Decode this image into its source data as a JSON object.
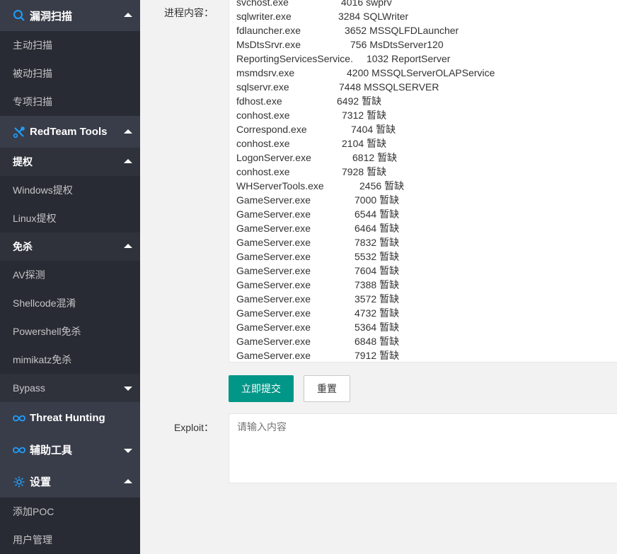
{
  "sidebar": {
    "vuln_scan": {
      "title": "漏洞扫描",
      "items": [
        "主动扫描",
        "被动扫描",
        "专项扫描"
      ]
    },
    "redteam": {
      "title": "RedTeam Tools",
      "privesc": {
        "title": "提权",
        "items": [
          "Windows提权",
          "Linux提权"
        ]
      },
      "evasion": {
        "title": "免杀",
        "items": [
          "AV探测",
          "Shellcode混淆",
          "Powershell免杀",
          "mimikatz免杀"
        ]
      },
      "bypass": {
        "title": "Bypass"
      }
    },
    "threat_hunting": {
      "title": "Threat Hunting"
    },
    "aux_tools": {
      "title": "辅助工具"
    },
    "settings": {
      "title": "设置",
      "items": [
        "添加POC",
        "用户管理"
      ]
    }
  },
  "form": {
    "process_label": "进程内容：",
    "processes": [
      {
        "name": "svchost.exe",
        "pid": "4016",
        "service": "swprv"
      },
      {
        "name": "sqlwriter.exe",
        "pid": "3284",
        "service": "SQLWriter"
      },
      {
        "name": "fdlauncher.exe",
        "pid": "3652",
        "service": "MSSQLFDLauncher"
      },
      {
        "name": "MsDtsSrvr.exe",
        "pid": "756",
        "service": "MsDtsServer120"
      },
      {
        "name": "ReportingServicesService.",
        "pid": "1032",
        "service": "ReportServer"
      },
      {
        "name": "msmdsrv.exe",
        "pid": "4200",
        "service": "MSSQLServerOLAPService"
      },
      {
        "name": "sqlservr.exe",
        "pid": "7448",
        "service": "MSSQLSERVER"
      },
      {
        "name": "fdhost.exe",
        "pid": "6492",
        "service": "暂缺"
      },
      {
        "name": "conhost.exe",
        "pid": "7312",
        "service": "暂缺"
      },
      {
        "name": "Correspond.exe",
        "pid": "7404",
        "service": "暂缺"
      },
      {
        "name": "conhost.exe",
        "pid": "2104",
        "service": "暂缺"
      },
      {
        "name": "LogonServer.exe",
        "pid": "6812",
        "service": "暂缺"
      },
      {
        "name": "conhost.exe",
        "pid": "7928",
        "service": "暂缺"
      },
      {
        "name": "WHServerTools.exe",
        "pid": "2456",
        "service": "暂缺"
      },
      {
        "name": "GameServer.exe",
        "pid": "7000",
        "service": "暂缺"
      },
      {
        "name": "GameServer.exe",
        "pid": "6544",
        "service": "暂缺"
      },
      {
        "name": "GameServer.exe",
        "pid": "6464",
        "service": "暂缺"
      },
      {
        "name": "GameServer.exe",
        "pid": "7832",
        "service": "暂缺"
      },
      {
        "name": "GameServer.exe",
        "pid": "5532",
        "service": "暂缺"
      },
      {
        "name": "GameServer.exe",
        "pid": "7604",
        "service": "暂缺"
      },
      {
        "name": "GameServer.exe",
        "pid": "7388",
        "service": "暂缺"
      },
      {
        "name": "GameServer.exe",
        "pid": "3572",
        "service": "暂缺"
      },
      {
        "name": "GameServer.exe",
        "pid": "4732",
        "service": "暂缺"
      },
      {
        "name": "GameServer.exe",
        "pid": "5364",
        "service": "暂缺"
      },
      {
        "name": "GameServer.exe",
        "pid": "6848",
        "service": "暂缺"
      },
      {
        "name": "GameServer.exe",
        "pid": "7912",
        "service": "暂缺"
      }
    ],
    "submit_label": "立即提交",
    "reset_label": "重置",
    "exploit_label": "Exploit：",
    "exploit_placeholder": "请输入内容"
  },
  "colors": {
    "sidebar_bg": "#393d49",
    "primary": "#009688",
    "icon_blue": "#1e9fff"
  },
  "icons": [
    "search-icon",
    "tools-icon",
    "infinity-icon",
    "infinity-icon",
    "gear-icon"
  ]
}
